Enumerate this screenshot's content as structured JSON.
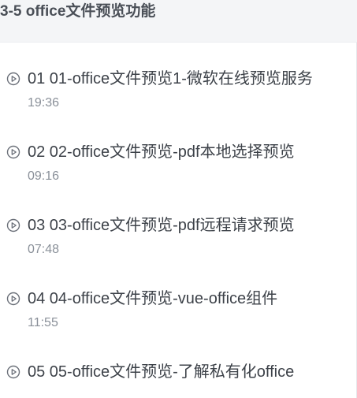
{
  "section": {
    "title": "3-5 office文件预览功能"
  },
  "lessons": [
    {
      "title": "01 01-office文件预览1-微软在线预览服务",
      "duration": "19:36",
      "icon": "play-circle-icon"
    },
    {
      "title": "02 02-office文件预览-pdf本地选择预览",
      "duration": "09:16",
      "icon": "play-circle-icon"
    },
    {
      "title": "03 03-office文件预览-pdf远程请求预览",
      "duration": "07:48",
      "icon": "play-circle-icon"
    },
    {
      "title": "04 04-office文件预览-vue-office组件",
      "duration": "11:55",
      "icon": "play-circle-icon"
    },
    {
      "title": "05 05-office文件预览-了解私有化office",
      "duration": "",
      "icon": "play-circle-icon"
    }
  ],
  "colors": {
    "header_bg": "#f4f5f7",
    "title_text": "#3d4249",
    "duration_text": "#8a9099",
    "icon_stroke": "#6b7079"
  }
}
